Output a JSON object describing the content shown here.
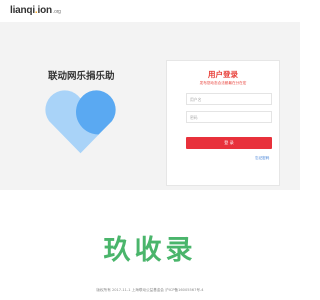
{
  "header": {
    "logo_main": "lianqi",
    "logo_dot": ".",
    "logo_rest": "ion",
    "logo_tld": ".org"
  },
  "hero": {
    "brand_title": "联动网乐捐乐助",
    "heart_colors": {
      "light": "#a9d3f8",
      "dark": "#5aa9f2"
    }
  },
  "login": {
    "title": "用户登录",
    "subtitle": "发布您动态合法都最在分在宏",
    "username_placeholder": "用户名",
    "password_placeholder": "密码",
    "submit_label": "登 录",
    "forgot_label": "忘记密码"
  },
  "domain_mark": "玖收录",
  "footer": {
    "text": "版权所有 2017-11-1  上海联动公益基金会  沪ICP备16005567号-4"
  },
  "colors": {
    "accent": "#e8413a",
    "button": "#e8313b",
    "link": "#3a7bd5",
    "watermark": "#4ab56b"
  }
}
